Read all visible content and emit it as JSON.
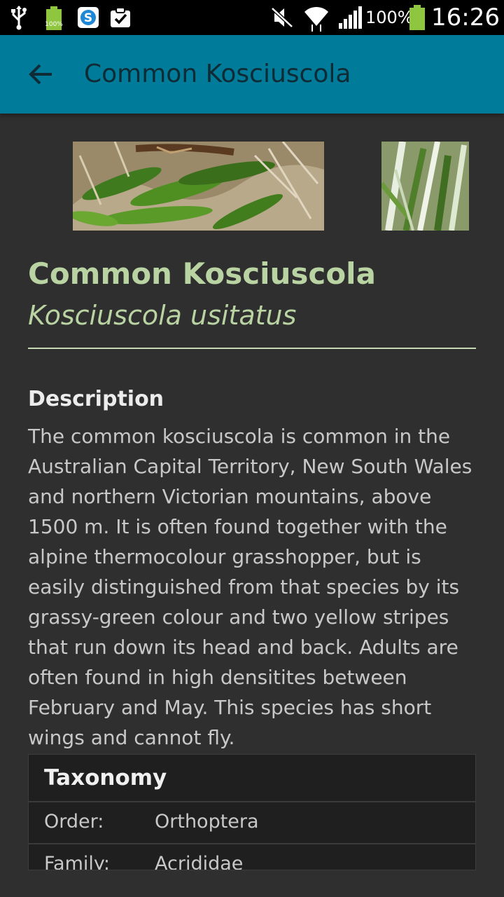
{
  "status_bar": {
    "battery_small_label": "100%",
    "battery_percent": "100%",
    "time": "16:26"
  },
  "app_bar": {
    "title": "Common Kosciuscola"
  },
  "species": {
    "common_name": "Common Kosciuscola",
    "scientific_name": "Kosciuscola usitatus"
  },
  "description": {
    "heading": "Description",
    "body": "The common kosciuscola is common in the Australian Capital Territory, New South Wales and northern Victorian mountains, above 1500 m. It is often found together with the alpine thermocolour grasshopper, but is easily distinguished from that species by its grassy-green colour and two yellow stripes that run down its head and back. Adults are often found in high densitites between February and May. This species has short wings and cannot fly."
  },
  "taxonomy": {
    "heading": "Taxonomy",
    "rows": [
      {
        "key": "Order:",
        "value": "Orthoptera"
      },
      {
        "key": "Family:",
        "value": "Acrididae"
      }
    ]
  },
  "colors": {
    "app_bar": "#007b9a",
    "background": "#2f2f2f",
    "accent_green": "#b9d3a2"
  }
}
